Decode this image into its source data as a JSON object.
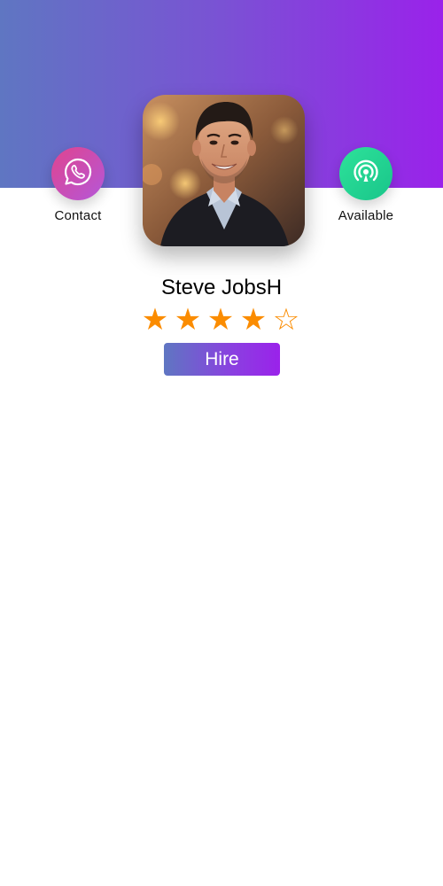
{
  "profile": {
    "name": "Steve JobsH",
    "rating": 4,
    "rating_max": 5
  },
  "actions": {
    "contact_label": "Contact",
    "available_label": "Available",
    "hire_label": "Hire"
  },
  "icons": {
    "contact": "phone-chat-icon",
    "available": "signal-broadcast-icon"
  },
  "colors": {
    "header_gradient_start": "#5f76c2",
    "header_gradient_end": "#9a22ea",
    "contact_circle_start": "#e0448e",
    "contact_circle_end": "#b457d9",
    "available_circle_start": "#2ee29a",
    "available_circle_end": "#19c58a",
    "star": "#fb8c00"
  }
}
